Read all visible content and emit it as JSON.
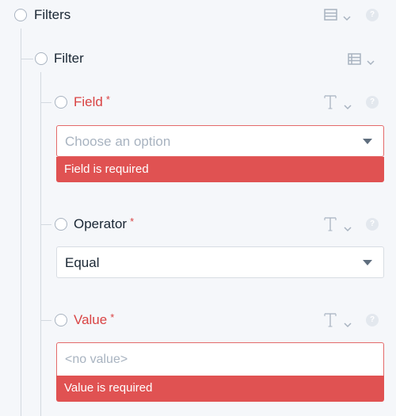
{
  "filters": {
    "label": "Filters",
    "layout_icon": "stacked-rows-icon"
  },
  "filter": {
    "label": "Filter",
    "layout_icon": "list-rows-icon"
  },
  "fields": {
    "field": {
      "label": "Field",
      "required_mark": "*",
      "type_icon": "text-type-icon",
      "placeholder": "Choose an option",
      "error": "Field is required"
    },
    "operator": {
      "label": "Operator",
      "required_mark": "*",
      "type_icon": "text-type-icon",
      "value": "Equal"
    },
    "value": {
      "label": "Value",
      "required_mark": "*",
      "type_icon": "text-type-icon",
      "placeholder": "<no value>",
      "error": "Value is required"
    }
  },
  "colors": {
    "error": "#d94343",
    "error_bar": "#e05252",
    "muted": "#a8b3c0",
    "background": "#f5f7fa"
  }
}
